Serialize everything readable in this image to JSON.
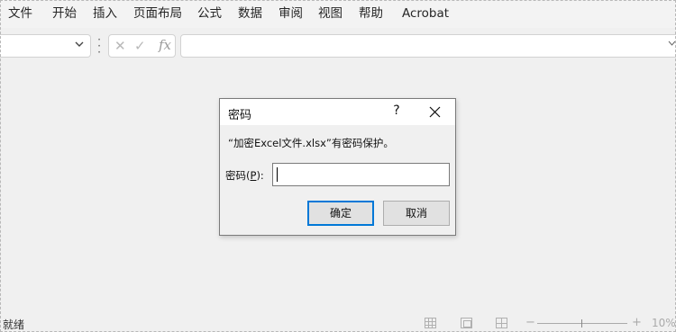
{
  "menu": {
    "items": [
      "文件",
      "开始",
      "插入",
      "页面布局",
      "公式",
      "数据",
      "审阅",
      "视图",
      "帮助",
      "Acrobat"
    ]
  },
  "formula_bar": {
    "name_box_value": "",
    "name_box_icon": "chevron-down-icon",
    "cancel_icon": "✕",
    "enter_icon": "✓",
    "fx_label": "fx",
    "formula_value": ""
  },
  "dialog": {
    "title": "密码",
    "help_label": "?",
    "close_label": "✕",
    "message": "“加密Excel文件.xlsx”有密码保护。",
    "password_label_prefix": "密码(",
    "password_label_accel": "P",
    "password_label_suffix": "):",
    "password_value": "",
    "ok_label": "确定",
    "cancel_label": "取消",
    "accent_color": "#0078d7"
  },
  "status": {
    "ready_text": "就绪",
    "zoom_minus": "−",
    "zoom_plus": "+",
    "zoom_level": "10%"
  }
}
